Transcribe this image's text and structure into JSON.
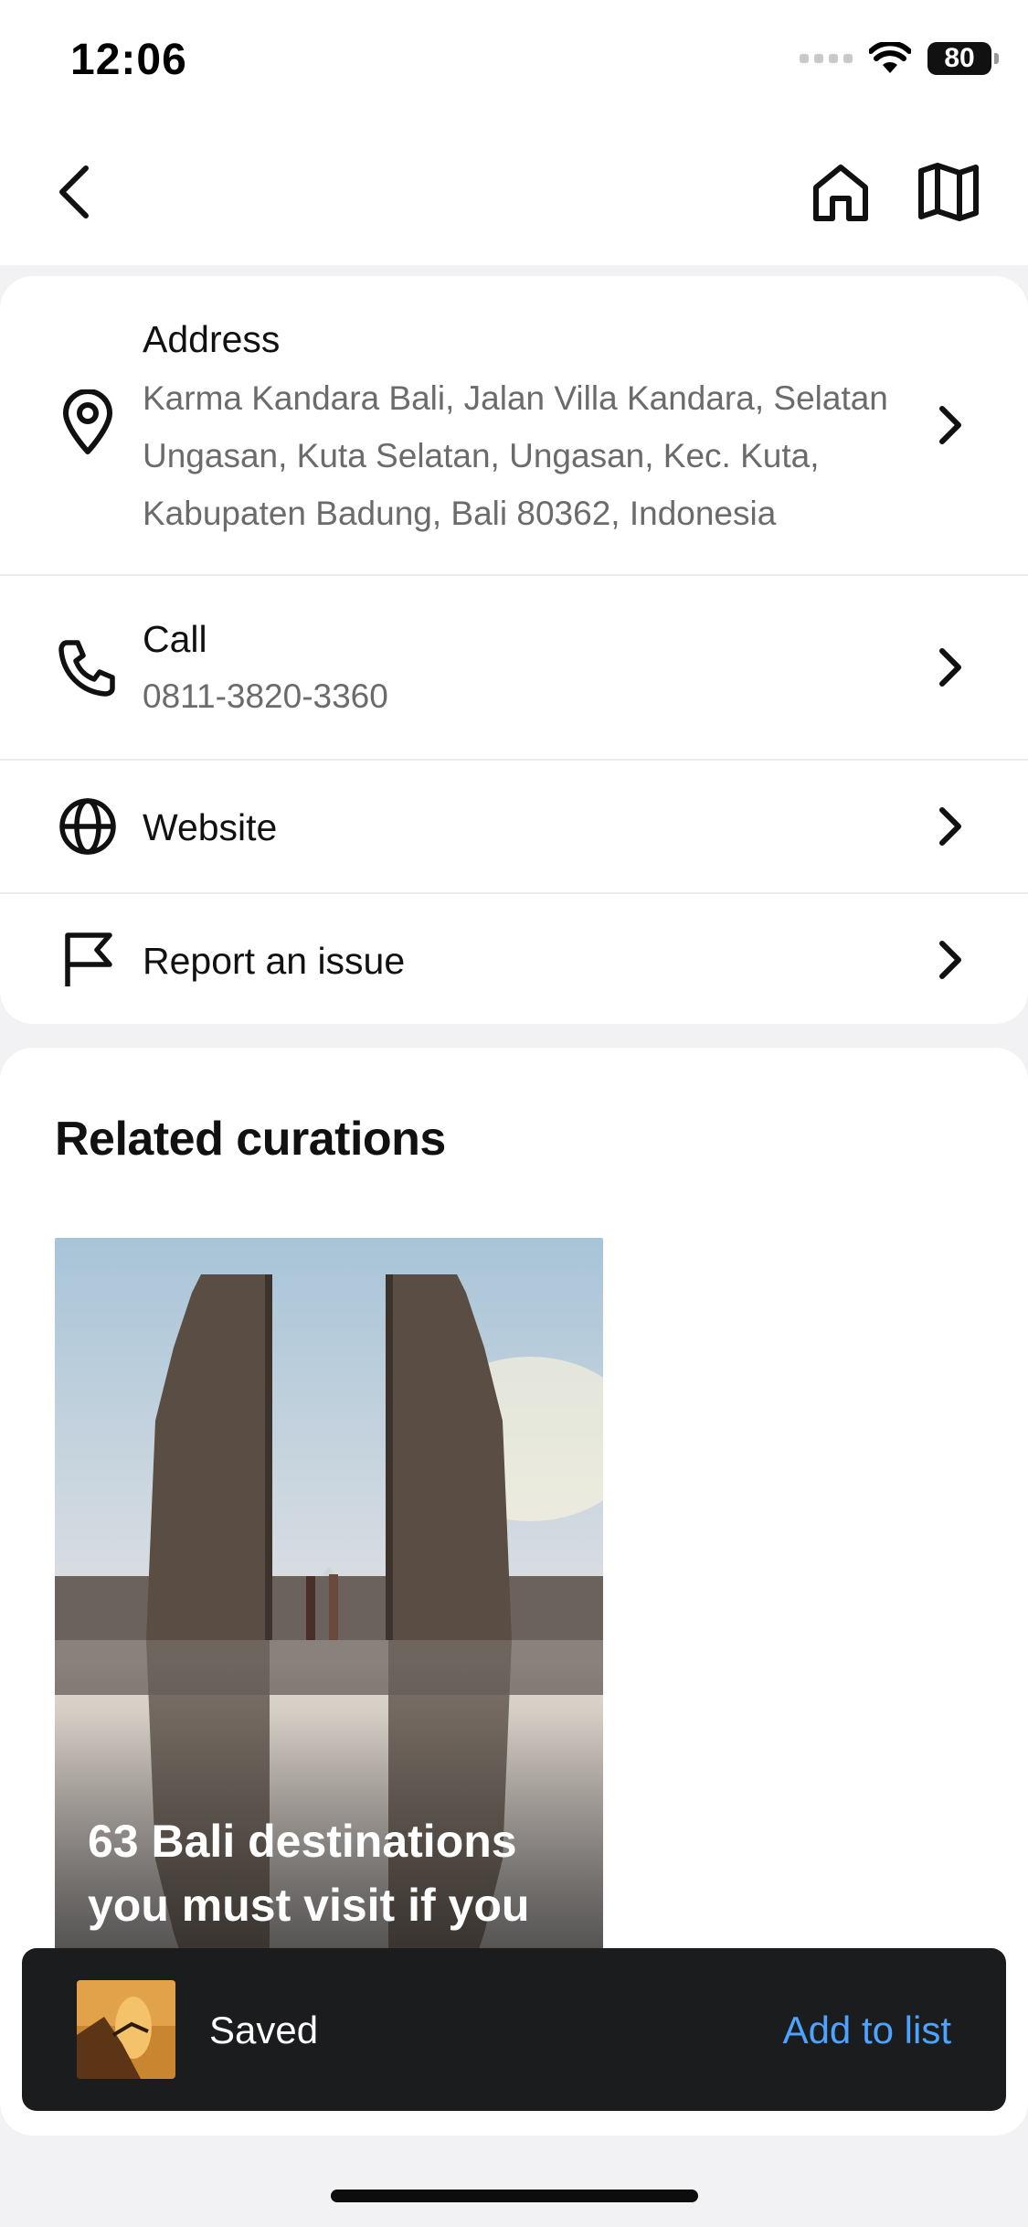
{
  "status_bar": {
    "time": "12:06",
    "battery": "80"
  },
  "nav": {
    "back_icon": "chevron-left-icon",
    "home_icon": "home-icon",
    "map_icon": "map-icon"
  },
  "info": {
    "address": {
      "title": "Address",
      "value": "Karma Kandara Bali, Jalan Villa Kandara, Selatan Ungasan, Kuta Selatan, Ungasan, Kec. Kuta, Kabupaten Badung, Bali 80362, Indonesia",
      "icon": "map-pin-icon"
    },
    "call": {
      "title": "Call",
      "value": "0811-3820-3360",
      "icon": "phone-icon"
    },
    "website": {
      "title": "Website",
      "icon": "globe-icon"
    },
    "report": {
      "title": "Report an issue",
      "icon": "flag-icon"
    }
  },
  "related": {
    "title": "Related curations",
    "cards": [
      {
        "title": "63 Bali destinations you must visit if you"
      }
    ]
  },
  "toast": {
    "text": "Saved",
    "action": "Add to list"
  },
  "colors": {
    "accent": "#4ea3ff",
    "toast_bg": "#1b1c1e"
  }
}
